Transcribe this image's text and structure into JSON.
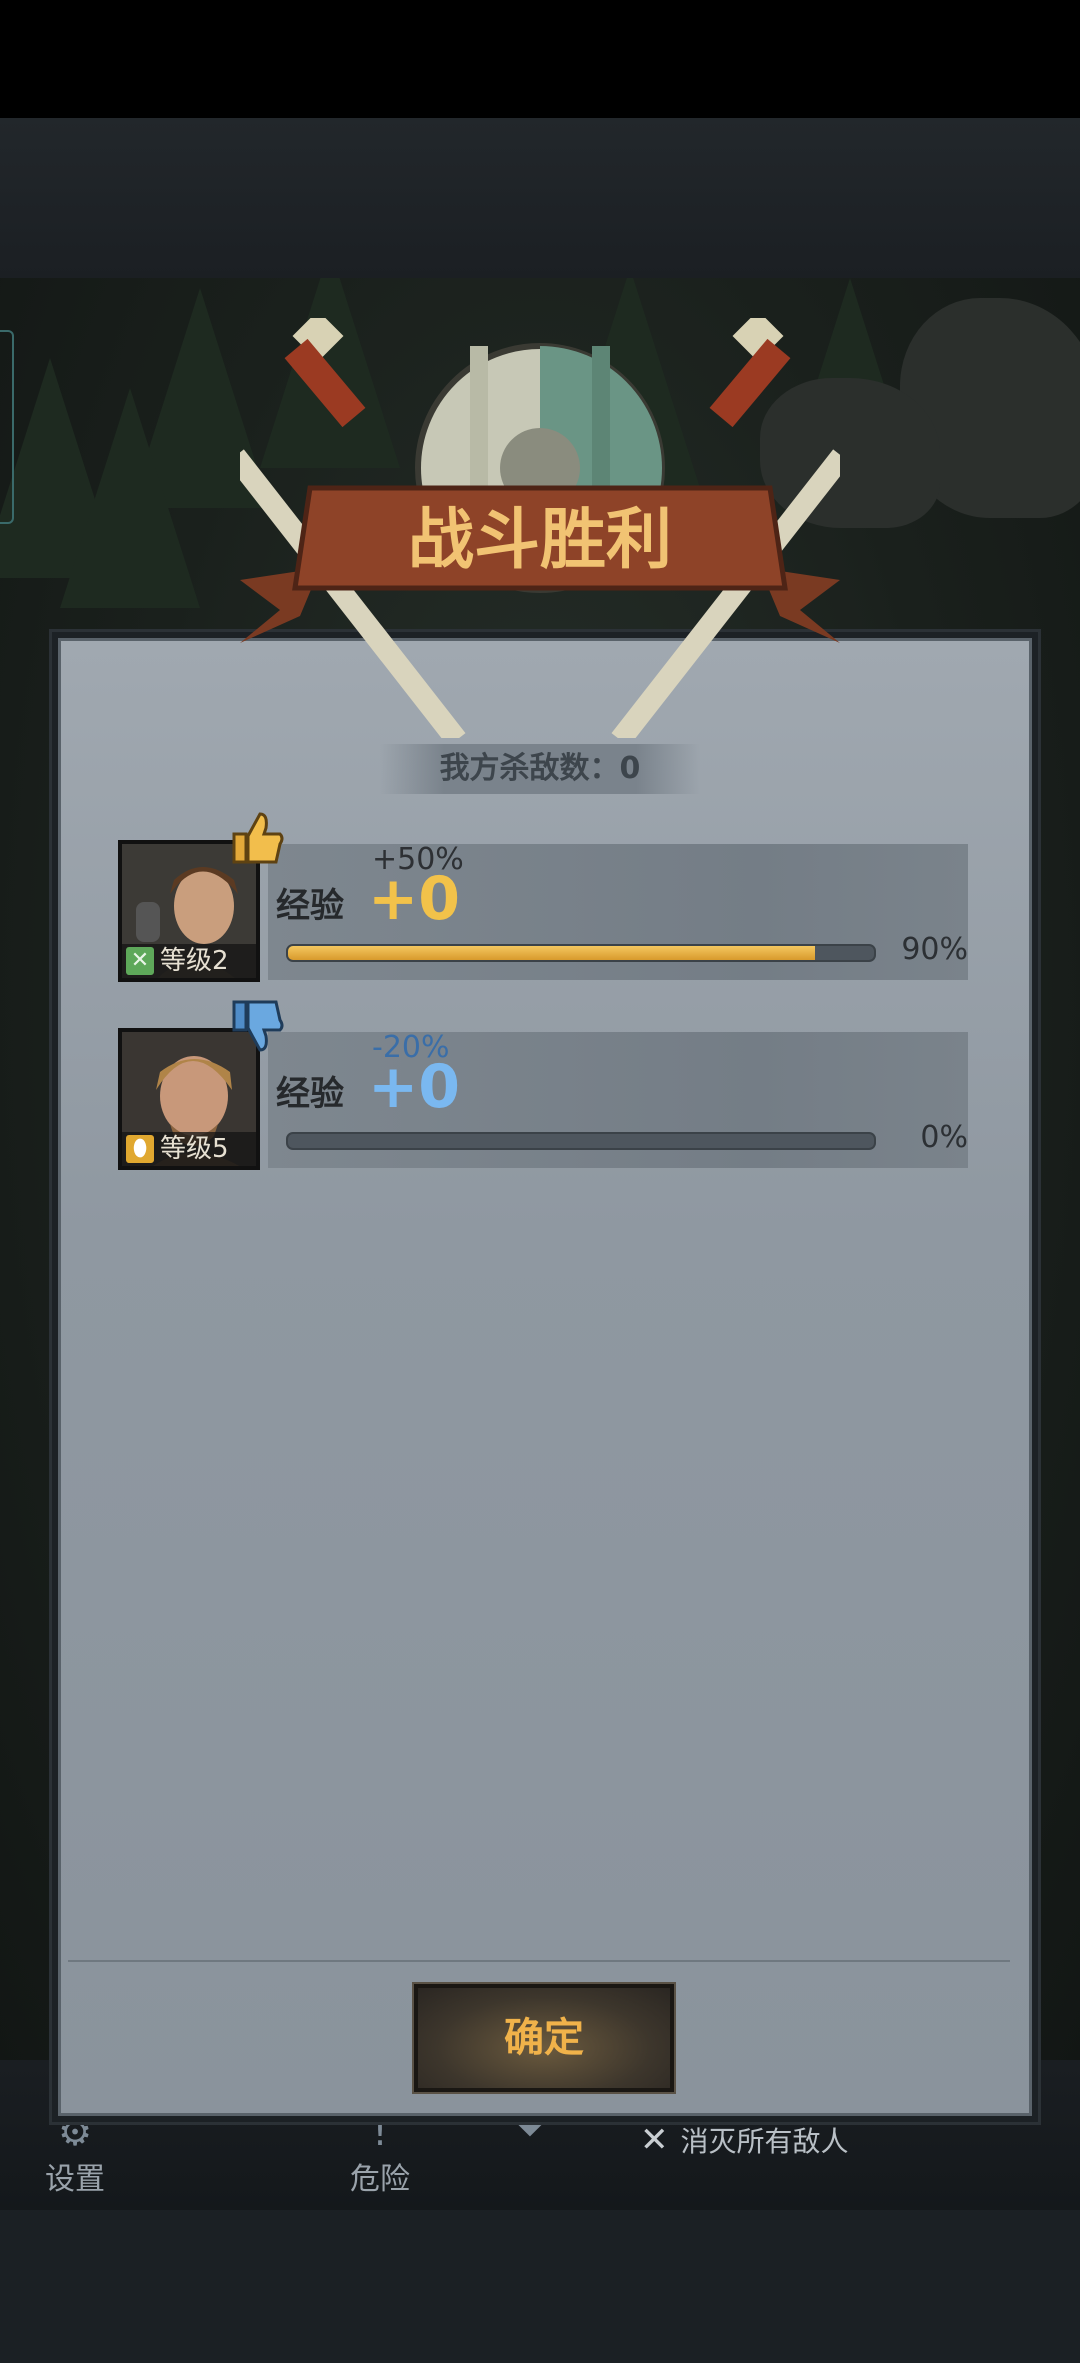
{
  "banner": {
    "title": "战斗胜利"
  },
  "kills": {
    "label": "我方杀敌数：0"
  },
  "units": [
    {
      "level_label": "等级2",
      "class_icon": "crossed-swords-icon",
      "class_color": "#5ea85a",
      "morale_icon": "thumbs-up-icon",
      "bonus": "+50%",
      "bonus_color": "#2d3034",
      "xp_label": "经验",
      "xp_value": "+0",
      "xp_color": "#f2c24a",
      "progress_pct": 90,
      "progress_text": "90%"
    },
    {
      "level_label": "等级5",
      "class_icon": "shield-icon",
      "class_color": "#e0a830",
      "morale_icon": "thumbs-down-icon",
      "bonus": "-20%",
      "bonus_color": "#3a6ea8",
      "xp_label": "经验",
      "xp_value": "+0",
      "xp_color": "#7ab8f0",
      "progress_pct": 0,
      "progress_text": "0%"
    }
  ],
  "confirm": {
    "label": "确定"
  },
  "hud": {
    "settings": "设置",
    "danger": "危险",
    "objective": "消灭所有敌人"
  }
}
